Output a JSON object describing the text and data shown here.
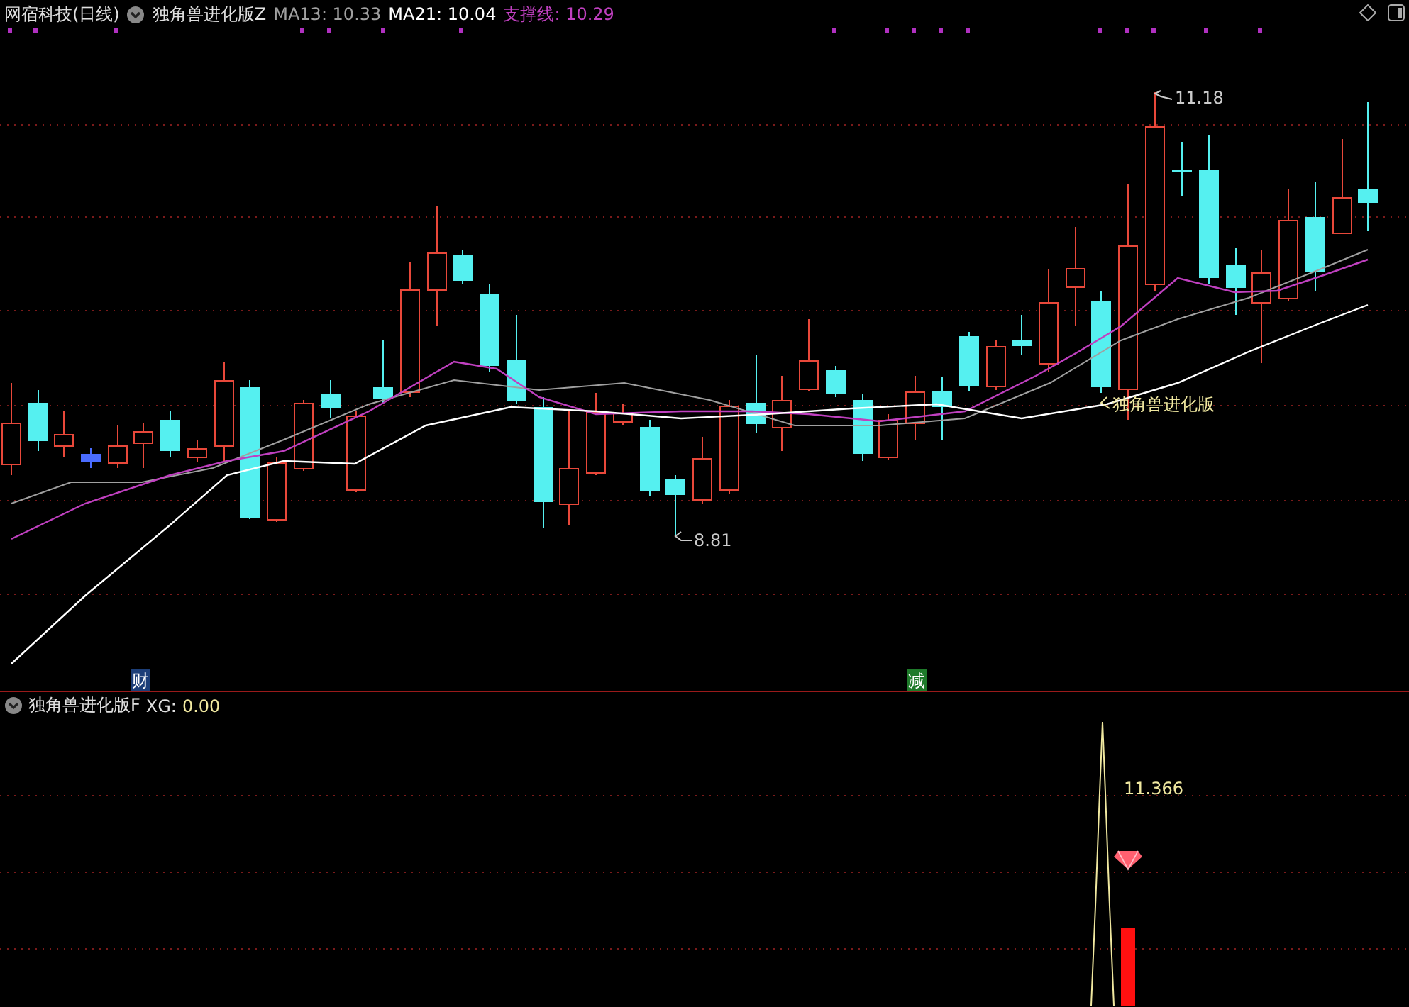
{
  "header": {
    "security": "网宿科技(日线)",
    "indicator": "独角兽进化版Z",
    "legend": [
      {
        "label": "MA13:",
        "value": "10.33",
        "color": "#a0a0a0"
      },
      {
        "label": "MA21:",
        "value": "10.04",
        "color": "#ffffff"
      },
      {
        "label": "支撑线:",
        "value": "10.29",
        "color": "#c040c0"
      }
    ]
  },
  "main_chart": {
    "high_label": "11.18",
    "low_label": "8.81",
    "signal_label": "独角兽进化版",
    "event_markers": [
      {
        "text": "财",
        "kind": "finance"
      },
      {
        "text": "减",
        "kind": "reduce"
      }
    ]
  },
  "sub_panel": {
    "indicator": "独角兽进化版F",
    "legend": [
      {
        "label": "XG:",
        "value": "0.00"
      }
    ],
    "peak_label": "11.366"
  }
}
